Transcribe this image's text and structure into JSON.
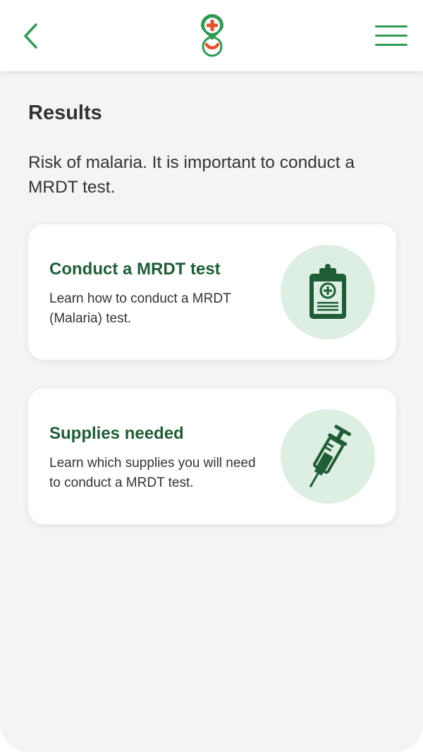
{
  "header": {
    "back_icon": "chevron-left-icon",
    "logo_icon": "health-location-logo",
    "menu_icon": "hamburger-menu-icon",
    "accent_color": "#2e9a52",
    "logo_red": "#e5512b"
  },
  "page": {
    "title": "Results",
    "description": "Risk of malaria. It is important to conduct a MRDT test."
  },
  "cards": [
    {
      "title": "Conduct a MRDT test",
      "text": "Learn how to conduct a MRDT (Malaria) test.",
      "icon": "clipboard-medical-icon"
    },
    {
      "title": "Supplies needed",
      "text": "Learn which supplies you will need to conduct a MRDT test.",
      "icon": "syringe-icon"
    }
  ],
  "colors": {
    "card_title": "#1f5d36",
    "icon_circle": "#ddeee3",
    "icon_fg": "#1f5d36",
    "background": "#f4f4f4"
  }
}
